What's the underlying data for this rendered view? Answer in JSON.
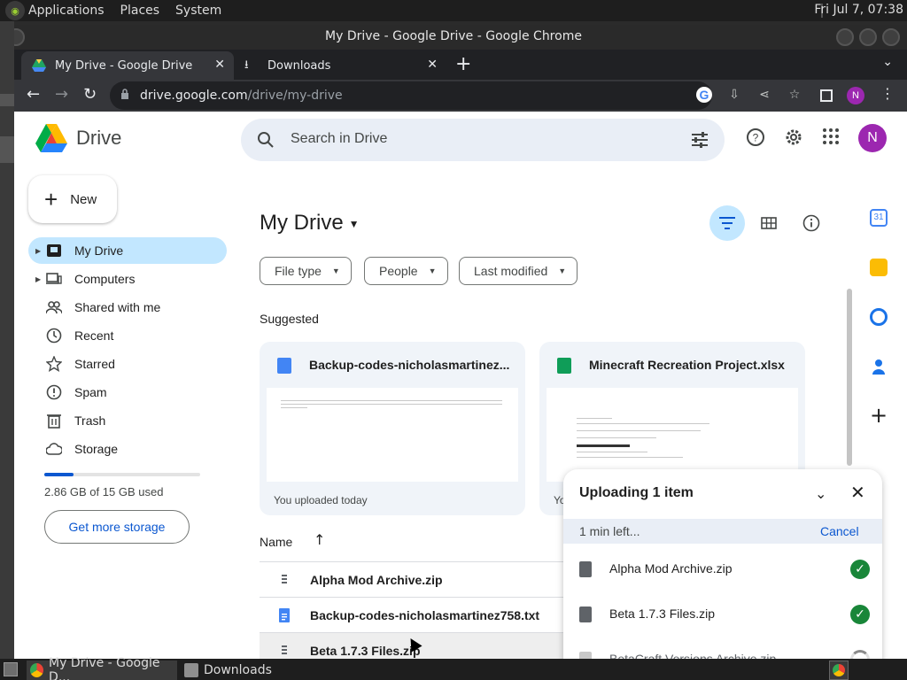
{
  "desktop": {
    "menus": [
      "Applications",
      "Places",
      "System"
    ],
    "clock": "Fri Jul  7, 07:38"
  },
  "window": {
    "title": "My Drive - Google Drive - Google Chrome"
  },
  "tabs": [
    {
      "label": "My Drive - Google Drive"
    },
    {
      "label": "Downloads"
    }
  ],
  "omnibox": {
    "host": "drive.google.com",
    "path": "/drive/my-drive"
  },
  "profile_initial": "N",
  "drive": {
    "logo_text": "Drive",
    "search_placeholder": "Search in Drive",
    "new_label": "New",
    "nav": [
      {
        "label": "My Drive",
        "icon": "my-drive-icon"
      },
      {
        "label": "Computers",
        "icon": "computers-icon"
      },
      {
        "label": "Shared with me",
        "icon": "shared-icon"
      },
      {
        "label": "Recent",
        "icon": "clock-icon"
      },
      {
        "label": "Starred",
        "icon": "star-icon"
      },
      {
        "label": "Spam",
        "icon": "spam-icon"
      },
      {
        "label": "Trash",
        "icon": "trash-icon"
      },
      {
        "label": "Storage",
        "icon": "cloud-icon"
      }
    ],
    "storage": {
      "used_text": "2.86 GB of 15 GB used",
      "fraction": 0.19
    },
    "get_storage_label": "Get more storage",
    "page_title": "My Drive",
    "filters": [
      "File type",
      "People",
      "Last modified"
    ],
    "suggested_label": "Suggested",
    "suggested": [
      {
        "name": "Backup-codes-nicholasmartinez...",
        "sub": "You uploaded today",
        "kind": "doc"
      },
      {
        "name": "Minecraft Recreation Project.xlsx",
        "sub": "Yo",
        "kind": "sheet"
      }
    ],
    "list_header": "Name",
    "files": [
      {
        "name": "Alpha Mod Archive.zip",
        "kind": "zip"
      },
      {
        "name": "Backup-codes-nicholasmartinez758.txt",
        "kind": "doc"
      },
      {
        "name": "Beta 1.7.3 Files.zip",
        "kind": "zip"
      }
    ]
  },
  "upload": {
    "title": "Uploading 1 item",
    "status": "1 min left...",
    "cancel": "Cancel",
    "items": [
      {
        "name": "Alpha Mod Archive.zip",
        "state": "done"
      },
      {
        "name": "Beta 1.7.3 Files.zip",
        "state": "done"
      },
      {
        "name": "BetaCraft Versions Archive.zip",
        "state": "uploading"
      }
    ]
  },
  "taskbar": {
    "items": [
      {
        "label": "My Drive - Google D..."
      },
      {
        "label": "Downloads"
      }
    ]
  },
  "colors": {
    "accent": "#0b57d0",
    "selected": "#c2e7ff",
    "avatar": "#9c27b0",
    "success": "#198639"
  }
}
